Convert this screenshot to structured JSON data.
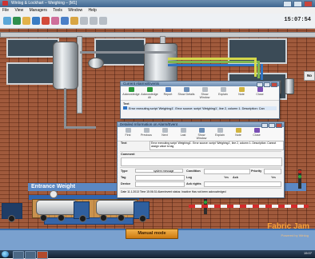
{
  "window": {
    "title": "Winlog & Lockhart – Weighing – [M1]",
    "controls": [
      "minimize",
      "maximize",
      "close"
    ]
  },
  "menubar": {
    "items": [
      "File",
      "View",
      "Managers",
      "Tools",
      "Window",
      "Help"
    ]
  },
  "toolbar": {
    "clock": "15:07:54",
    "icons": [
      "open-icon",
      "save-icon",
      "users-icon",
      "alarm-icon",
      "bell-icon",
      "trend-icon",
      "print-icon",
      "report-icon",
      "refresh-icon",
      "settings-icon",
      "help-icon"
    ]
  },
  "scene": {
    "entrance_label": "Entrance Weight",
    "side_label": "No",
    "manual_button": "Manual mode",
    "brand": "Fabric Jam",
    "brand_sub": "Powered by Winlog"
  },
  "alarm_window": {
    "title": "Current Alarms/Events",
    "tools": [
      "Acknowledge",
      "Acknowledge All",
      "Report",
      "Show Details",
      "Show Window",
      "Explain",
      "Note",
      "Close"
    ],
    "text_header": "Text",
    "message": "Error executing script 'Weighing1'. Error source: script 'Weighing1', line 2, column 1. Description: Can"
  },
  "detail_window": {
    "title": "Detailed Information on Alarm/Event",
    "tools": [
      "First",
      "Previous",
      "Next",
      "Last",
      "Show Window",
      "Explain",
      "Note",
      "Close"
    ],
    "text_label": "Text",
    "text_value": "Error executing script 'Weighing1'. Error source: script 'Weighing1', line 2, column 1. Description: Cannot assign value to tag",
    "comment_label": "Comment",
    "type_label": "Type",
    "type_value": "system message",
    "condition_label": "Condition",
    "priority_label": "Priority",
    "tag_label": "Tag",
    "log_label": "Log",
    "yes1": "Yes",
    "ack_label": "Ack",
    "yes2": "Yes",
    "device_label": "Device",
    "ack_rights_label": "Ack rights",
    "footer": "Date 11.1.2013  Time 15:06:31     Alarm/event status: Inactive  Has not been acknowledged"
  },
  "taskbar": {
    "time": "15:07"
  }
}
